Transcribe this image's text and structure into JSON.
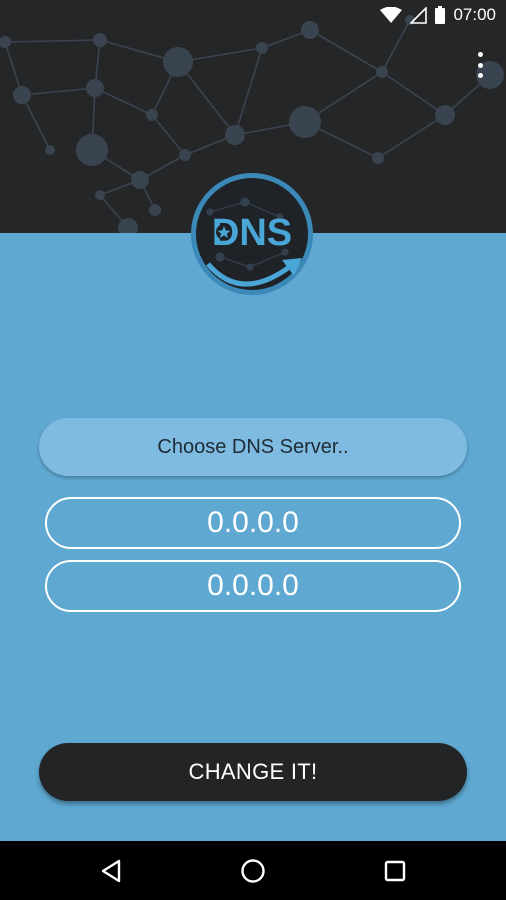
{
  "status_bar": {
    "time": "07:00",
    "icons": [
      "wifi-icon",
      "cell-signal-icon",
      "battery-icon"
    ]
  },
  "header": {
    "logo_text": "DNS",
    "menu_icon": "overflow-menu-icon"
  },
  "main": {
    "choose_server_label": "Choose DNS Server..",
    "dns_primary_value": "0.0.0.0",
    "dns_secondary_value": "0.0.0.0",
    "change_button_label": "CHANGE IT!"
  },
  "nav_bar": {
    "icons": [
      "back-icon",
      "home-icon",
      "recents-icon"
    ]
  },
  "colors": {
    "background": "#5ea8d2",
    "header": "#252628",
    "accent": "#4aa6d6",
    "choose_button": "#7fbbe0",
    "change_button": "#232426"
  }
}
